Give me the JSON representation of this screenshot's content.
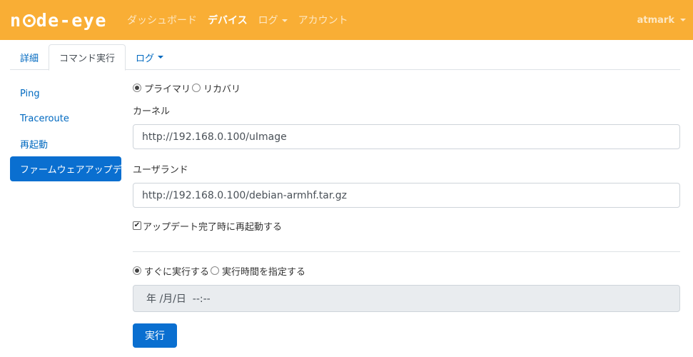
{
  "navbar": {
    "brand_pre": "n",
    "brand_post": "de-eye",
    "links": [
      {
        "label": "ダッシュボード",
        "active": false,
        "dropdown": false
      },
      {
        "label": "デバイス",
        "active": true,
        "dropdown": false
      },
      {
        "label": "ログ",
        "active": false,
        "dropdown": true
      },
      {
        "label": "アカウント",
        "active": false,
        "dropdown": false
      }
    ],
    "user": "atmark",
    "color": "#f9ae35"
  },
  "tabs": [
    {
      "label": "詳細",
      "active": false
    },
    {
      "label": "コマンド実行",
      "active": true
    },
    {
      "label": "ログ",
      "active": false,
      "dropdown": true
    }
  ],
  "sidebar": {
    "items": [
      {
        "label": "Ping",
        "active": false
      },
      {
        "label": "Traceroute",
        "active": false
      },
      {
        "label": "再起動",
        "active": false
      },
      {
        "label": "ファームウェアアップデート",
        "active": true
      }
    ],
    "accent": "#0a6fd0"
  },
  "form": {
    "target": {
      "options": [
        "プライマリ",
        "リカバリ"
      ],
      "selected": "プライマリ"
    },
    "kernel_label": "カーネル",
    "kernel_value": "http://192.168.0.100/uImage",
    "userland_label": "ユーザランド",
    "userland_value": "http://192.168.0.100/debian-armhf.tar.gz",
    "reboot_label": "アップデート完了時に再起動する",
    "reboot_checked": true,
    "schedule": {
      "options": [
        "すぐに実行する",
        "実行時間を指定する"
      ],
      "selected": "すぐに実行する"
    },
    "datetime_display": "年 /月/日  --:--",
    "submit_label": "実行"
  }
}
